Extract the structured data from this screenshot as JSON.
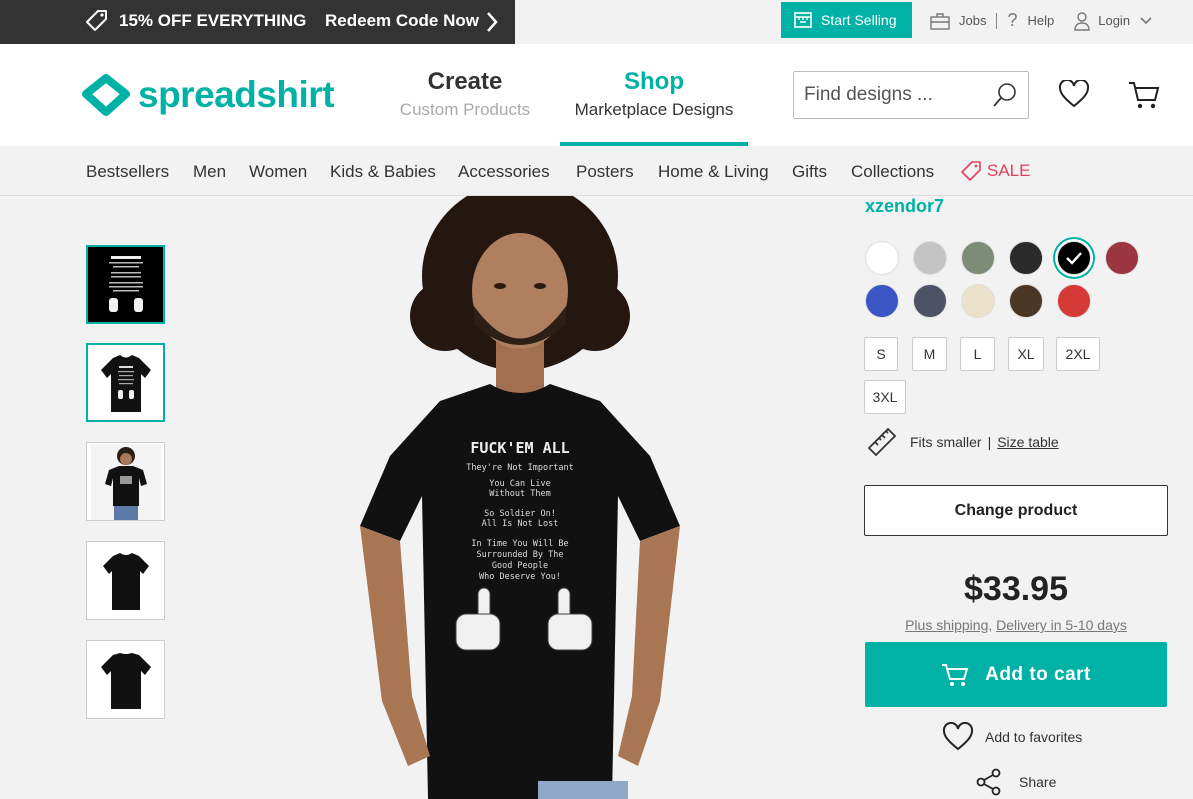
{
  "promo": {
    "discount": "15% OFF EVERYTHING",
    "redeem": "Redeem Code Now"
  },
  "topnav": {
    "start_selling": "Start Selling",
    "jobs": "Jobs",
    "help": "Help",
    "login": "Login"
  },
  "header": {
    "logo": "spreadshirt",
    "create_title": "Create",
    "create_sub": "Custom Products",
    "shop_title": "Shop",
    "shop_sub": "Marketplace Designs",
    "search_placeholder": "Find designs ..."
  },
  "categories": [
    "Bestsellers",
    "Men",
    "Women",
    "Kids & Babies",
    "Accessories",
    "Posters",
    "Home & Living",
    "Gifts",
    "Collections",
    "SALE"
  ],
  "product": {
    "designer": "xzendor7",
    "colors": [
      "#ffffff",
      "#c4c4c4",
      "#7c8c76",
      "#2a2a2a",
      "#000000",
      "#9b3640",
      "#3a56c4",
      "#4e5265",
      "#ece2cc",
      "#4a3625",
      "#d53a36"
    ],
    "selected_color_index": 4,
    "sizes": [
      "S",
      "M",
      "L",
      "XL",
      "2XL",
      "3XL"
    ],
    "fit_note": "Fits smaller",
    "size_table": "Size table",
    "change_product": "Change product",
    "price": "$33.95",
    "plus_shipping": "Plus shipping",
    "delivery": "Delivery in 5-10 days",
    "add_to_cart": "Add to cart",
    "add_to_favorites": "Add to favorites",
    "share": "Share"
  },
  "shirt_print": {
    "headline": "FUCK'EM ALL",
    "lines": [
      "They're Not Important",
      "You Can Live",
      "Without Them",
      "So Soldier On!",
      "All Is Not Lost",
      "In Time You Will Be",
      "Surrounded By The",
      "Good People",
      "Who Deserve You!"
    ]
  },
  "accent_color": "#00b2a5"
}
